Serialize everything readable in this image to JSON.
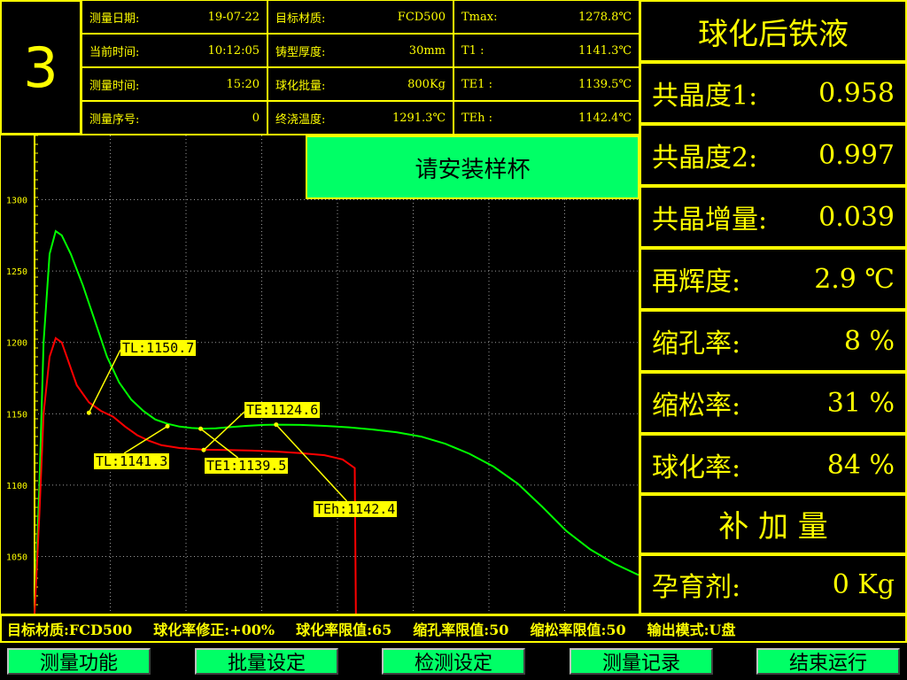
{
  "measure_no": "3",
  "info": {
    "col1": [
      {
        "label": "测量日期:",
        "value": "19-07-22"
      },
      {
        "label": "当前时间:",
        "value": "10:12:05"
      },
      {
        "label": "测量时间:",
        "value": "15:20"
      },
      {
        "label": "测量序号:",
        "value": "0"
      }
    ],
    "col2": [
      {
        "label": "目标材质:",
        "value": "FCD500"
      },
      {
        "label": "铸型厚度:",
        "value": "30mm"
      },
      {
        "label": "球化批量:",
        "value": "800Kg"
      },
      {
        "label": "终浇温度:",
        "value": "1291.3℃"
      }
    ],
    "col3": [
      {
        "label": "Tmax:",
        "value": "1278.8℃"
      },
      {
        "label": "T1  :",
        "value": "1141.3℃"
      },
      {
        "label": "TE1 :",
        "value": "1139.5℃"
      },
      {
        "label": "TEh :",
        "value": "1142.4℃"
      }
    ]
  },
  "status_message": "请安装样杯",
  "right_panel": {
    "title": "球化后铁液",
    "rows": [
      {
        "label": "共晶度1:",
        "value": "0.958"
      },
      {
        "label": "共晶度2:",
        "value": "0.997"
      },
      {
        "label": "共晶增量:",
        "value": "0.039"
      },
      {
        "label": "再辉度:",
        "value": "2.9 ℃"
      },
      {
        "label": "缩孔率:",
        "value": "8   %"
      },
      {
        "label": "缩松率:",
        "value": "31  %"
      },
      {
        "label": "球化率:",
        "value": "84  %"
      }
    ],
    "supplement_title": "补  加  量",
    "inoculant_label": "孕育剂:",
    "inoculant_value": "0 Kg"
  },
  "bottom_bar": [
    "目标材质:FCD500",
    "球化率修正:+00%",
    "球化率限值:65",
    "缩孔率限值:50",
    "缩松率限值:50",
    "输出模式:U盘"
  ],
  "function_buttons": [
    "测量功能",
    "批量设定",
    "检测设定",
    "测量记录",
    "结束运行"
  ],
  "chart_data": {
    "type": "line",
    "y_ticks": [
      "1300",
      "1250",
      "1200",
      "1150",
      "1100",
      "1050"
    ],
    "ylim": [
      1010,
      1345
    ],
    "xlim": [
      0,
      100
    ],
    "grid": true,
    "colors": {
      "green": "#00ff00",
      "red": "#ff0000",
      "label_bg": "#ffff00"
    },
    "series": [
      {
        "color": "green",
        "points": [
          [
            0,
            1010
          ],
          [
            0.8,
            1100
          ],
          [
            1.5,
            1200
          ],
          [
            2.5,
            1262
          ],
          [
            3.5,
            1278
          ],
          [
            4.5,
            1275
          ],
          [
            6,
            1262
          ],
          [
            8,
            1240
          ],
          [
            10,
            1215
          ],
          [
            12,
            1190
          ],
          [
            14,
            1172
          ],
          [
            16,
            1160
          ],
          [
            18,
            1152
          ],
          [
            20,
            1146
          ],
          [
            22,
            1143
          ],
          [
            24,
            1141
          ],
          [
            26,
            1140
          ],
          [
            28,
            1139.6
          ],
          [
            30,
            1139.8
          ],
          [
            32,
            1140.5
          ],
          [
            35,
            1141.5
          ],
          [
            38,
            1142.2
          ],
          [
            40,
            1142.4
          ],
          [
            44,
            1142.2
          ],
          [
            48,
            1141.5
          ],
          [
            52,
            1140.5
          ],
          [
            56,
            1139
          ],
          [
            60,
            1137
          ],
          [
            64,
            1134
          ],
          [
            68,
            1129
          ],
          [
            72,
            1122
          ],
          [
            76,
            1113
          ],
          [
            80,
            1101
          ],
          [
            84,
            1085
          ],
          [
            88,
            1068
          ],
          [
            92,
            1055
          ],
          [
            96,
            1045
          ],
          [
            100,
            1037
          ]
        ]
      },
      {
        "color": "red",
        "points": [
          [
            0,
            1010
          ],
          [
            0.8,
            1080
          ],
          [
            1.5,
            1150
          ],
          [
            2.5,
            1190
          ],
          [
            3.5,
            1203
          ],
          [
            4.5,
            1200
          ],
          [
            5.5,
            1188
          ],
          [
            7,
            1170
          ],
          [
            9,
            1158
          ],
          [
            11,
            1152
          ],
          [
            13,
            1148
          ],
          [
            15,
            1141
          ],
          [
            17,
            1135
          ],
          [
            19,
            1131
          ],
          [
            21,
            1128
          ],
          [
            24,
            1126
          ],
          [
            28,
            1124.8
          ],
          [
            32,
            1124.6
          ],
          [
            36,
            1124.2
          ],
          [
            40,
            1123.5
          ],
          [
            44,
            1122.5
          ],
          [
            48,
            1121
          ],
          [
            51,
            1118
          ],
          [
            53,
            1112
          ],
          [
            53.2,
            1010
          ]
        ]
      }
    ],
    "annotations": [
      {
        "text": "TL:1150.7",
        "point": [
          9,
          1150.7
        ]
      },
      {
        "text": "TE:1124.6",
        "point": [
          28,
          1124.6
        ]
      },
      {
        "text": "TL:1141.3",
        "point": [
          22,
          1141.3
        ]
      },
      {
        "text": "TE1:1139.5",
        "point": [
          27.5,
          1139.5
        ]
      },
      {
        "text": "TEh:1142.4",
        "point": [
          40,
          1142.4
        ]
      }
    ]
  }
}
